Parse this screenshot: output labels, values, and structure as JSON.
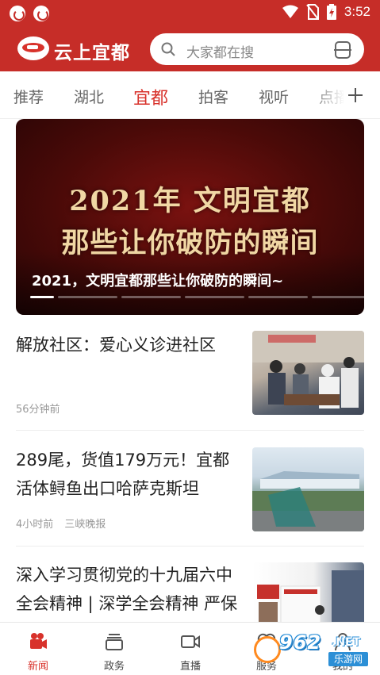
{
  "status_bar": {
    "time": "3:52"
  },
  "app": {
    "title": "云上宜都",
    "search_placeholder": "大家都在搜"
  },
  "tabs": [
    {
      "label": "推荐",
      "active": false
    },
    {
      "label": "湖北",
      "active": false
    },
    {
      "label": "宜都",
      "active": true
    },
    {
      "label": "拍客",
      "active": false
    },
    {
      "label": "视听",
      "active": false
    },
    {
      "label": "点播",
      "active": false
    }
  ],
  "banner": {
    "image_text_line1": "2021年 文明宜都",
    "image_text_line2": "那些让你破防的瞬间",
    "caption": "2021，文明宜都那些让你破防的瞬间~",
    "slide_count": 6,
    "active_slide": 0
  },
  "news": [
    {
      "title": "解放社区：爱心义诊进社区",
      "time": "56分钟前",
      "source": ""
    },
    {
      "title": "289尾，货值179万元！宜都活体鲟鱼出口哈萨克斯坦",
      "time": "4小时前",
      "source": "三峡晚报"
    },
    {
      "title": "深入学习贯彻党的十九届六中全会精神 | 深学全会精神 严保燃气安全",
      "time": "",
      "source": ""
    }
  ],
  "bottom_nav": [
    {
      "label": "新闻",
      "icon": "video-camera-icon",
      "active": true
    },
    {
      "label": "政务",
      "icon": "document-stack-icon",
      "active": false
    },
    {
      "label": "直播",
      "icon": "live-video-icon",
      "active": false
    },
    {
      "label": "服务",
      "icon": "heart-icon",
      "active": false
    },
    {
      "label": "我的",
      "icon": "person-icon",
      "active": false
    }
  ],
  "watermark": {
    "number": "962",
    "suffix": ".NET",
    "site": "乐游网"
  },
  "colors": {
    "brand": "#c62d28",
    "accent": "#d8322b"
  }
}
